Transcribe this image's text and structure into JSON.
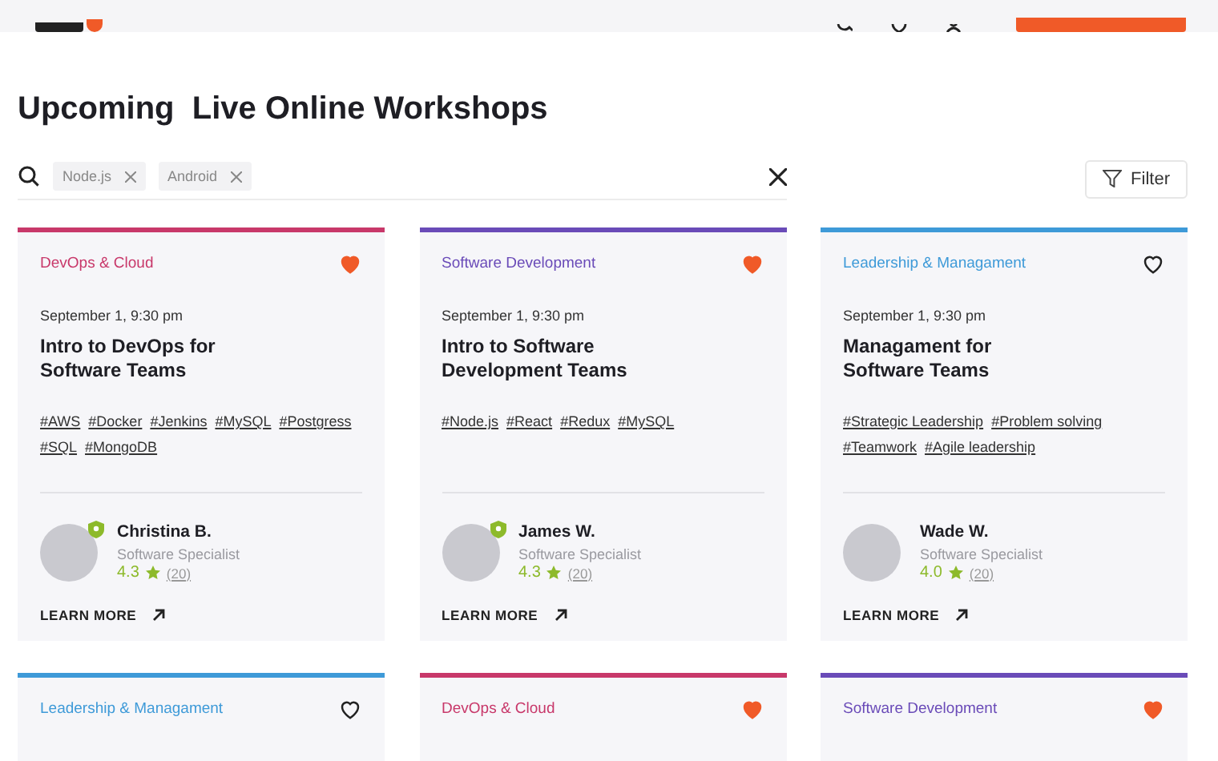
{
  "page_title": "Upcoming  Live Online Workshops",
  "search": {
    "chips": [
      {
        "label": "Node.js"
      },
      {
        "label": "Android"
      }
    ]
  },
  "filter_button": "Filter",
  "workshops": [
    {
      "category": "DevOps & Cloud",
      "color": "#c8386a",
      "liked": true,
      "date": "September 1, 9:30 pm",
      "title": "Intro to DevOps for\nSoftware Teams",
      "tags": [
        "#AWS",
        "#Docker",
        "#Jenkins",
        "#MySQL",
        "#Postgress",
        "#SQL",
        "#MongoDB"
      ],
      "instructor": {
        "name": "Christina B.",
        "role": "Software Specialist",
        "rating": "4.3",
        "reviews": "(20)",
        "verified": true
      },
      "link": "LEARN MORE"
    },
    {
      "category": "Software Development",
      "color": "#6a4bb8",
      "liked": true,
      "date": "September 1, 9:30 pm",
      "title": "Intro to Software\nDevelopment Teams",
      "tags": [
        "#Node.js",
        "#React",
        "#Redux",
        "#MySQL"
      ],
      "instructor": {
        "name": "James W.",
        "role": "Software Specialist",
        "rating": "4.3",
        "reviews": "(20)",
        "verified": true
      },
      "link": "LEARN MORE"
    },
    {
      "category": "Leadership & Managament",
      "color": "#3e9ad8",
      "liked": false,
      "date": "September 1, 9:30 pm",
      "title": "Managament for\nSoftware Teams",
      "tags": [
        "#Strategic Leadership",
        "#Problem solving",
        "#Teamwork",
        "#Agile leadership"
      ],
      "instructor": {
        "name": "Wade W.",
        "role": "Software Specialist",
        "rating": "4.0",
        "reviews": "(20)",
        "verified": false
      },
      "link": "LEARN MORE"
    }
  ],
  "more_workshops": [
    {
      "category": "Leadership & Managament",
      "color": "#3e9ad8",
      "liked": false
    },
    {
      "category": "DevOps & Cloud",
      "color": "#c8386a",
      "liked": true
    },
    {
      "category": "Software Development",
      "color": "#6a4bb8",
      "liked": true
    }
  ]
}
